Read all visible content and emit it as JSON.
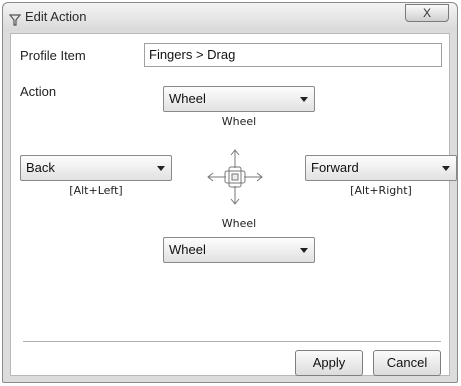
{
  "window": {
    "title": "Edit Action",
    "close_label": "X"
  },
  "profile_item": {
    "label": "Profile Item",
    "value": "Fingers > Drag"
  },
  "action": {
    "label": "Action"
  },
  "directions": {
    "up": {
      "selected": "Wheel",
      "caption": "Wheel"
    },
    "left": {
      "selected": "Back",
      "caption": "[Alt+Left]"
    },
    "right": {
      "selected": "Forward",
      "caption": "[Alt+Right]"
    },
    "down": {
      "selected": "Wheel",
      "caption": "Wheel"
    }
  },
  "center_icon": "four-direction-gesture-icon",
  "buttons": {
    "apply": "Apply",
    "cancel": "Cancel"
  }
}
